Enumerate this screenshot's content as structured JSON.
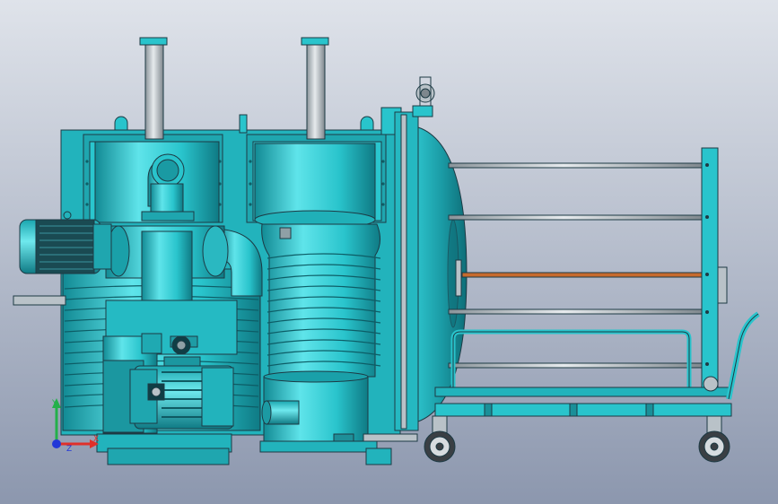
{
  "viewport": {
    "background_top": "#dfe3ea",
    "background_bottom": "#8c97ae"
  },
  "model": {
    "body_color": "#29c4cc",
    "body_light": "#5fe4ea",
    "body_dark": "#128a94",
    "outline_color": "#1d3a44",
    "metal_color": "#b9c2c8",
    "motor_dark": "#17414a",
    "copper_rod": "#c76b2e",
    "tire_color": "#3a3f44"
  },
  "triad": {
    "x_label": "X",
    "y_label": "Y",
    "z_label": "Z",
    "x_color": "#e0302a",
    "y_color": "#23b04a",
    "z_color": "#2238d8"
  }
}
